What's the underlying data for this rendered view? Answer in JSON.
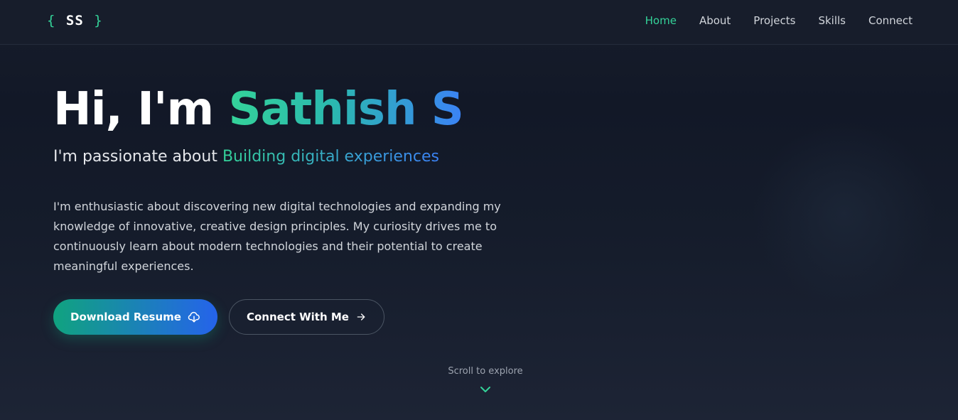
{
  "brand": {
    "open_brace": "{",
    "initials": "SS",
    "close_brace": "}"
  },
  "nav": {
    "items": [
      {
        "label": "Home",
        "active": true
      },
      {
        "label": "About",
        "active": false
      },
      {
        "label": "Projects",
        "active": false
      },
      {
        "label": "Skills",
        "active": false
      },
      {
        "label": "Connect",
        "active": false
      }
    ]
  },
  "hero": {
    "greeting": "Hi, I'm ",
    "name": "Sathish S",
    "tagline_prefix": "I'm passionate about ",
    "tagline_accent": "Building digital experiences",
    "bio": "I'm enthusiastic about discovering new digital technologies and expanding my knowledge of innovative, creative design principles. My curiosity drives me to continuously learn about modern technologies and their potential to create meaningful experiences.",
    "primary_button": {
      "label": "Download Resume",
      "icon": "cloud-download-icon"
    },
    "secondary_button": {
      "label": "Connect With Me",
      "icon": "arrow-right-icon"
    }
  },
  "scroll": {
    "label": "Scroll to explore",
    "icon": "chevron-down-icon"
  },
  "colors": {
    "background": "#121827",
    "accent_green": "#34d399",
    "accent_blue": "#3b82f6",
    "text_primary": "#ffffff",
    "text_muted": "#d1d5db"
  }
}
